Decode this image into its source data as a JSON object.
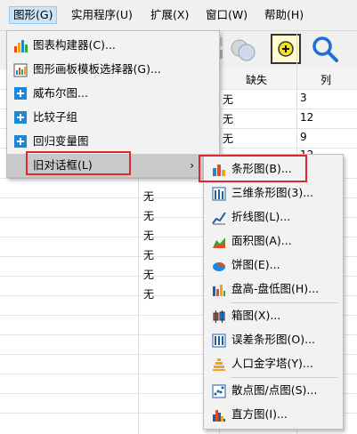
{
  "menubar": {
    "items": [
      {
        "label": "图形(G)",
        "active": true
      },
      {
        "label": "实用程序(U)"
      },
      {
        "label": "扩展(X)"
      },
      {
        "label": "窗口(W)"
      },
      {
        "label": "帮助(H)"
      }
    ]
  },
  "grid": {
    "headers": {
      "missing": "缺失",
      "column": "列"
    },
    "top_rows": [
      {
        "missing": "无",
        "column": "3"
      },
      {
        "missing": "无",
        "column": "12"
      },
      {
        "missing": "无",
        "column": "9"
      },
      {
        "missing": "",
        "column": "12"
      }
    ],
    "left_cells": [
      "无",
      "无",
      "无",
      "无",
      "无",
      "无"
    ]
  },
  "main_menu": {
    "items": [
      {
        "label": "图表构建器(C)...",
        "icon": "chart-builder-icon"
      },
      {
        "label": "图形画板模板选择器(G)...",
        "icon": "graphboard-icon"
      },
      {
        "label": "威布尔图...",
        "icon": "plus-box-icon"
      },
      {
        "label": "比较子组",
        "icon": "plus-box-icon"
      },
      {
        "label": "回归变量图",
        "icon": "plus-box-icon"
      },
      {
        "label": "旧对话框(L)",
        "submenu_arrow": "›"
      }
    ]
  },
  "sub_menu": {
    "groups": [
      [
        {
          "label": "条形图(B)...",
          "icon": "bar-chart-icon"
        },
        {
          "label": "三维条形图(3)...",
          "icon": "3d-bar-chart-icon"
        },
        {
          "label": "折线图(L)...",
          "icon": "line-chart-icon"
        },
        {
          "label": "面积图(A)...",
          "icon": "area-chart-icon"
        },
        {
          "label": "饼图(E)...",
          "icon": "pie-chart-icon"
        },
        {
          "label": "盘高-盘低图(H)...",
          "icon": "high-low-chart-icon"
        }
      ],
      [
        {
          "label": "箱图(X)...",
          "icon": "boxplot-icon"
        },
        {
          "label": "误差条形图(O)...",
          "icon": "error-bar-icon"
        },
        {
          "label": "人口金字塔(Y)...",
          "icon": "pyramid-icon"
        }
      ],
      [
        {
          "label": "散点图/点图(S)...",
          "icon": "scatter-icon"
        },
        {
          "label": "直方图(I)...",
          "icon": "histogram-icon"
        }
      ]
    ]
  },
  "colors": {
    "highlight": "#c9c9c9",
    "red_box": "#e0262f",
    "accent": "#1e88d8"
  }
}
